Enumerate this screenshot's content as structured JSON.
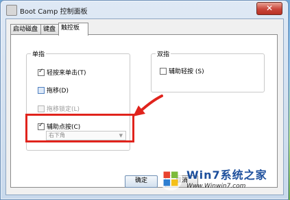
{
  "window": {
    "title": "Boot Camp 控制面板",
    "close_glyph": "✕"
  },
  "tabs": [
    {
      "label": "启动磁盘",
      "active": false
    },
    {
      "label": "键盘",
      "active": false
    },
    {
      "label": "触控板",
      "active": true
    }
  ],
  "single_finger": {
    "title": "单指",
    "options": [
      {
        "label": "轻按来单击(T)",
        "checked": true,
        "enabled": true
      },
      {
        "label": "拖移(D)",
        "checked": false,
        "enabled": true
      },
      {
        "label": "拖移锁定(L)",
        "checked": false,
        "enabled": false
      },
      {
        "label": "辅助点按(C)",
        "checked": true,
        "enabled": true
      }
    ],
    "secondary_select": {
      "value": "右下角"
    }
  },
  "two_finger": {
    "title": "双指",
    "options": [
      {
        "label": "辅助轻按 (S)",
        "checked": false,
        "enabled": true
      }
    ]
  },
  "buttons": {
    "ok": "确定",
    "cancel": "取消"
  },
  "watermark": {
    "brand": "Win7系统之家",
    "url": "Www.Winwin7.com"
  },
  "colors": {
    "annotation": "#e0231c",
    "title_close": "#c9463a"
  }
}
